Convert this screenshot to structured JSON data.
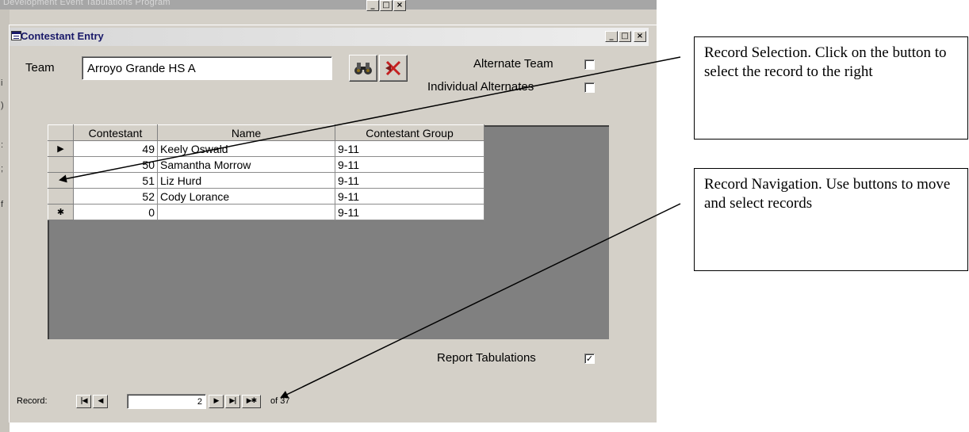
{
  "background_window": {
    "title": "Development Event Tabulations Program"
  },
  "child_window": {
    "title": "Contestant Entry"
  },
  "team": {
    "label": "Team",
    "value": "Arroyo Grande HS A"
  },
  "toolbar": {
    "find_icon": "binoculars-icon",
    "delete_icon": "delete-record-icon"
  },
  "options": {
    "alternate_team_label": "Alternate Team",
    "alternate_team_checked": false,
    "individual_alternates_label": "Individual Alternates",
    "individual_alternates_checked": false,
    "report_tabulations_label": "Report Tabulations",
    "report_tabulations_checked": true
  },
  "datasheet": {
    "columns": [
      "Contestant",
      "Name",
      "Contestant Group"
    ],
    "rows": [
      {
        "selector": "▶",
        "contestant": "49",
        "name": "Keely Oswald",
        "group": "9-11"
      },
      {
        "selector": "",
        "contestant": "50",
        "name": "Samantha Morrow",
        "group": "9-11"
      },
      {
        "selector": "",
        "contestant": "51",
        "name": "Liz Hurd",
        "group": "9-11"
      },
      {
        "selector": "",
        "contestant": "52",
        "name": "Cody Lorance",
        "group": "9-11"
      },
      {
        "selector": "✱",
        "contestant": "0",
        "name": "",
        "group": "9-11"
      }
    ]
  },
  "record_nav": {
    "label": "Record:",
    "current": "2",
    "of_label": "of  37"
  },
  "callouts": {
    "selection": "Record Selection.  Click on the button to select the record to the right",
    "navigation": "Record Navigation.  Use buttons to move and select records"
  }
}
